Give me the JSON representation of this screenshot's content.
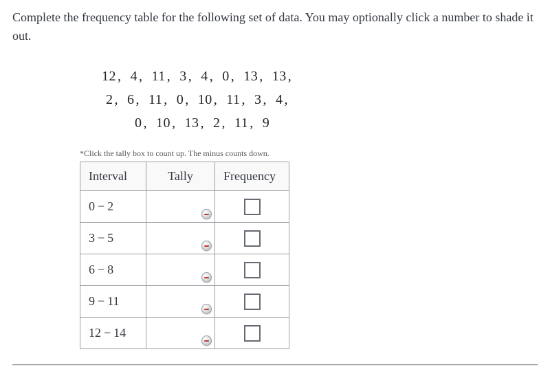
{
  "instructions": "Complete the frequency table for the following set of data. You may optionally click a number to shade it out.",
  "data_rows": [
    [
      "12",
      "4",
      "11",
      "3",
      "4",
      "0",
      "13",
      "13"
    ],
    [
      "2",
      "6",
      "11",
      "0",
      "10",
      "11",
      "3",
      "4"
    ],
    [
      "0",
      "10",
      "13",
      "2",
      "11",
      "9"
    ]
  ],
  "hint": "*Click the tally box to count up. The minus counts down.",
  "table": {
    "headers": {
      "interval": "Interval",
      "tally": "Tally",
      "frequency": "Frequency"
    },
    "rows": [
      {
        "low": "0",
        "high": "2"
      },
      {
        "low": "3",
        "high": "5"
      },
      {
        "low": "6",
        "high": "8"
      },
      {
        "low": "9",
        "high": "11"
      },
      {
        "low": "12",
        "high": "14"
      }
    ]
  },
  "symbols": {
    "comma": ",",
    "dash": "−"
  }
}
